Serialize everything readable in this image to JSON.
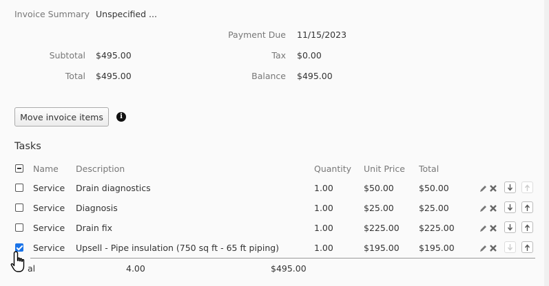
{
  "summary": {
    "invoice_summary_label": "Invoice Summary",
    "invoice_summary_value": "Unspecified ...",
    "payment_due_label": "Payment Due",
    "payment_due_value": "11/15/2023",
    "subtotal_label": "Subtotal",
    "subtotal_value": "$495.00",
    "tax_label": "Tax",
    "tax_value": "$0.00",
    "total_label": "Total",
    "total_value": "$495.00",
    "balance_label": "Balance",
    "balance_value": "$495.00"
  },
  "actions": {
    "move_items_label": "Move invoice items",
    "info_glyph": "i"
  },
  "tasks": {
    "title": "Tasks",
    "headers": {
      "name": "Name",
      "description": "Description",
      "quantity": "Quantity",
      "unit_price": "Unit Price",
      "total": "Total"
    },
    "rows": [
      {
        "name": "Service",
        "description": "Drain diagnostics",
        "quantity": "1.00",
        "unit_price": "$50.00",
        "total": "$50.00",
        "checked": false
      },
      {
        "name": "Service",
        "description": "Diagnosis",
        "quantity": "1.00",
        "unit_price": "$25.00",
        "total": "$25.00",
        "checked": false
      },
      {
        "name": "Service",
        "description": "Drain fix",
        "quantity": "1.00",
        "unit_price": "$225.00",
        "total": "$225.00",
        "checked": false
      },
      {
        "name": "Service",
        "description": "Upsell - Pipe insulation (750 sq ft - 65 ft piping)",
        "quantity": "1.00",
        "unit_price": "$195.00",
        "total": "$195.00",
        "checked": true
      }
    ],
    "footer": {
      "label": "al",
      "quantity": "4.00",
      "total": "$495.00"
    }
  },
  "icons": {
    "edit": "pencil-icon",
    "delete": "x-icon",
    "move_down": "arrow-down-icon",
    "move_up": "arrow-up-icon",
    "info": "info-icon",
    "cursor": "hand-pointer-icon"
  }
}
